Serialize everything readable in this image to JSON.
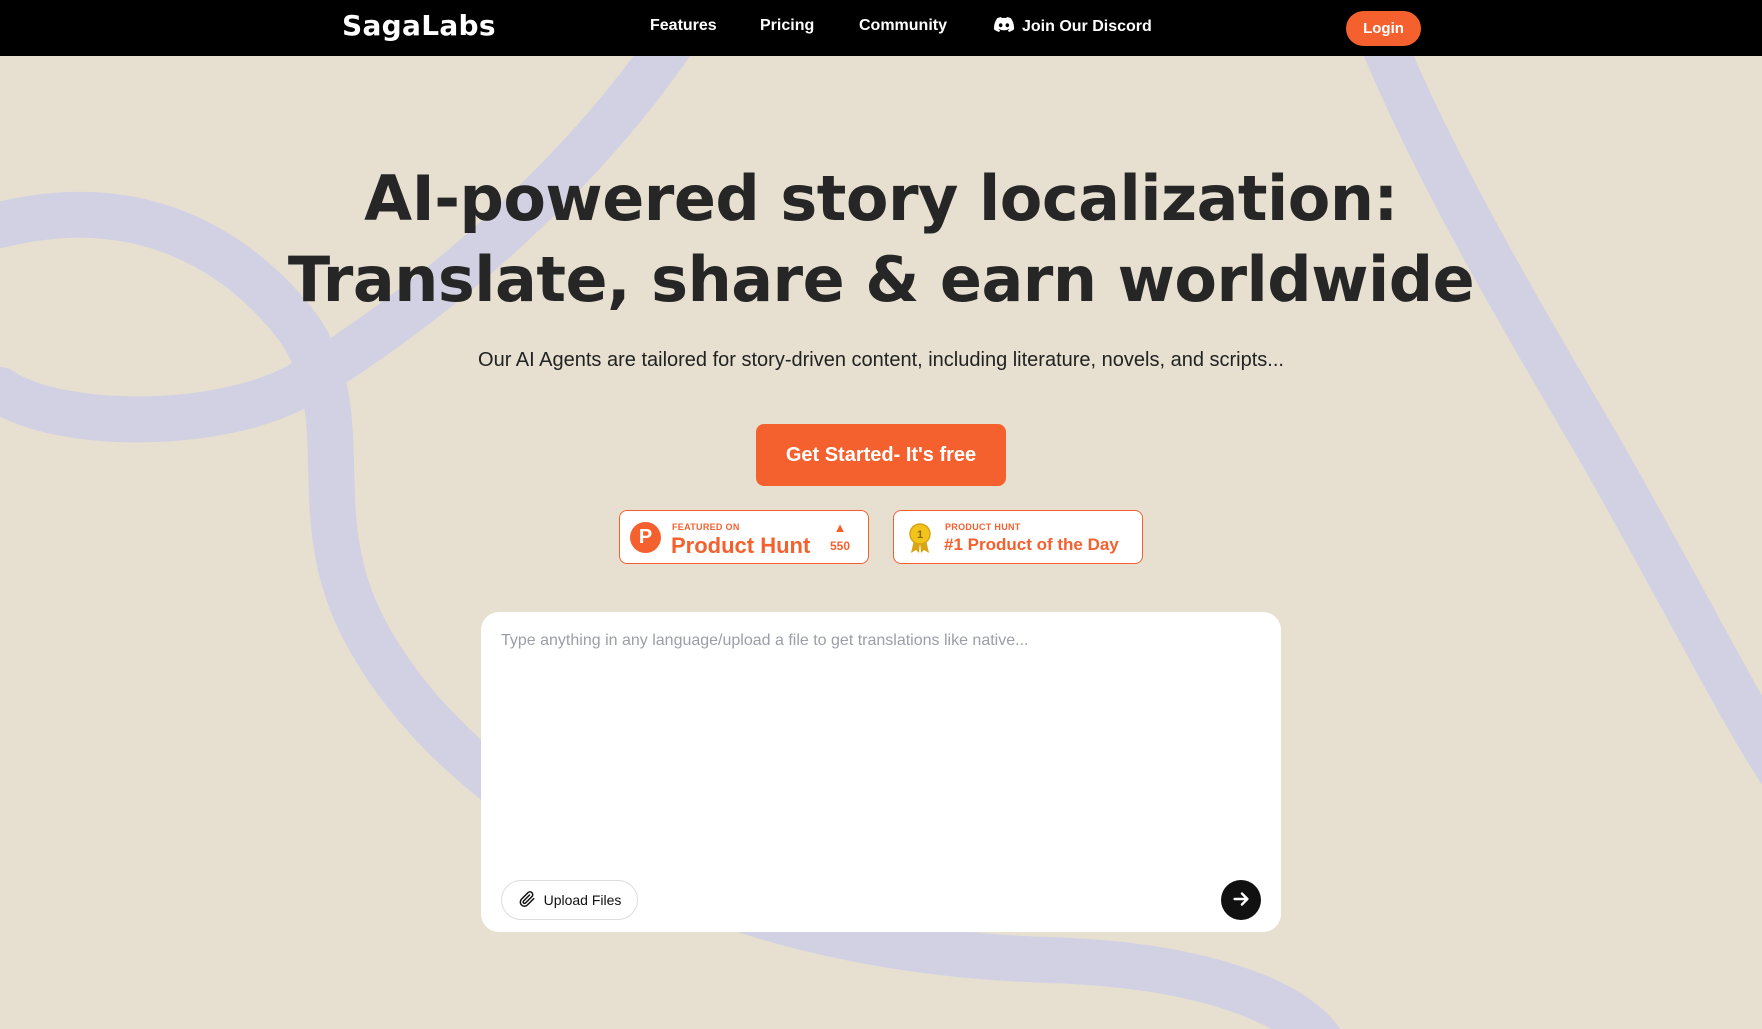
{
  "brand": {
    "logo_text": "SagaLabs"
  },
  "nav": {
    "links": [
      "Features",
      "Pricing",
      "Community"
    ],
    "discord_label": "Join Our Discord",
    "login_label": "Login"
  },
  "hero": {
    "headline_line1": "AI-powered story localization:",
    "headline_line2": "Translate, share & earn worldwide",
    "subheadline": "Our AI Agents are tailored for story-driven content, including literature, novels, and scripts...",
    "cta_label": "Get Started- It's free"
  },
  "badges": {
    "product_hunt": {
      "eyebrow": "FEATURED ON",
      "title": "Product Hunt",
      "upvotes": "550",
      "logo_letter": "P"
    },
    "product_of_day": {
      "eyebrow": "PRODUCT HUNT",
      "title": "#1 Product of the Day",
      "medal_number": "1"
    }
  },
  "composer": {
    "placeholder": "Type anything in any language/upload a file to get translations like native...",
    "upload_label": "Upload Files"
  },
  "colors": {
    "accent": "#f4612f",
    "background": "#e7e0d0",
    "swirl": "#d2d1e3",
    "navbar": "#000000"
  },
  "icons": {
    "discord": "discord-icon",
    "paperclip": "paperclip-icon",
    "send": "arrow-right-icon",
    "medal": "medal-icon",
    "upvote": "triangle-up-icon"
  }
}
